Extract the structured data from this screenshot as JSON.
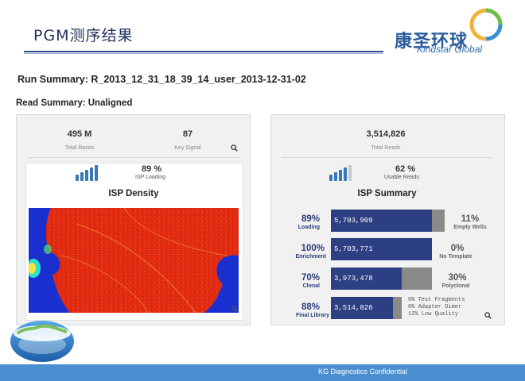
{
  "header": {
    "title": "PGM测序结果",
    "logo_cn": "康圣环球",
    "logo_en": "Kindstar Global"
  },
  "run_summary": "Run Summary: R_2013_12_31_18_39_14_user_2013-12-31-02",
  "read_summary": "Read Summary: Unaligned",
  "left_panel": {
    "total_bases_value": "495 M",
    "total_bases_label": "Total Bases",
    "key_signal_value": "87",
    "key_signal_label": "Key Signal",
    "isp_loading_pct": "89 %",
    "isp_loading_label": "ISP Loading",
    "isp_loading_fraction": 0.89,
    "density_title": "ISP Density"
  },
  "right_panel": {
    "total_reads_value": "3,514,826",
    "total_reads_label": "Total Reads",
    "usable_pct": "62 %",
    "usable_label": "Usable Reads",
    "usable_fraction": 0.62,
    "summary_title": "ISP Summary",
    "rows": [
      {
        "pct": "89%",
        "label": "Loading",
        "value": "5,703,909",
        "fill": 0.89,
        "right_pct": "11%",
        "right_label": "Empty Wells"
      },
      {
        "pct": "100%",
        "label": "Enrichment",
        "value": "5,703,771",
        "fill": 1.0,
        "right_pct": "0%",
        "right_label": "No Template"
      },
      {
        "pct": "70%",
        "label": "Clonal",
        "value": "3,973,478",
        "fill": 0.7,
        "right_pct": "30%",
        "right_label": "Polyclonal"
      },
      {
        "pct": "88%",
        "label": "Final Library",
        "value": "3,514,826",
        "fill": 0.88
      }
    ],
    "quality_lines": [
      "0% Test Fragments",
      "0% Adapter Dimer",
      "12% Low Quality"
    ]
  },
  "footer": {
    "text": "KG Diagnostics Confidential"
  },
  "colors": {
    "footer": "#4b8fd0",
    "bar_blue": "#2c3f82",
    "bar_gray": "#8a8a8a",
    "density_red": "#e02a12",
    "density_blue": "#1a2fd0"
  }
}
